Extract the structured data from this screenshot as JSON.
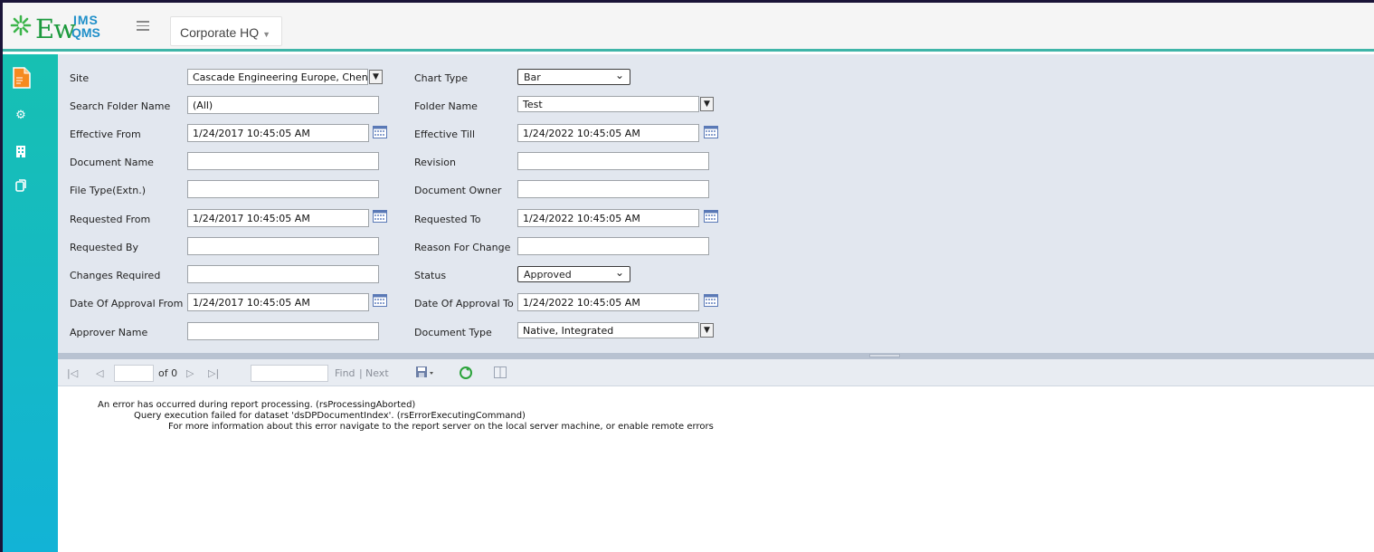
{
  "header": {
    "logo_main": "Ew",
    "logo_top": "IMS",
    "logo_bottom": "QMS",
    "site_selector": "Corporate HQ"
  },
  "sidebar": {
    "items": [
      {
        "icon": "document-icon"
      },
      {
        "icon": "gears-icon"
      },
      {
        "icon": "building-icon"
      },
      {
        "icon": "copy-icon"
      }
    ]
  },
  "params": {
    "site": {
      "label": "Site",
      "value": "Cascade Engineering Europe, Chenr"
    },
    "chart_type": {
      "label": "Chart Type",
      "value": "Bar"
    },
    "search_folder_name": {
      "label": "Search Folder Name",
      "value": "(All)"
    },
    "folder_name": {
      "label": "Folder Name",
      "value": "Test"
    },
    "effective_from": {
      "label": "Effective From",
      "value": "1/24/2017 10:45:05 AM"
    },
    "effective_till": {
      "label": "Effective Till",
      "value": "1/24/2022 10:45:05 AM"
    },
    "document_name": {
      "label": "Document Name",
      "value": ""
    },
    "revision": {
      "label": "Revision",
      "value": ""
    },
    "file_type": {
      "label": "File Type(Extn.)",
      "value": ""
    },
    "document_owner": {
      "label": "Document Owner",
      "value": ""
    },
    "requested_from": {
      "label": "Requested From",
      "value": "1/24/2017 10:45:05 AM"
    },
    "requested_to": {
      "label": "Requested To",
      "value": "1/24/2022 10:45:05 AM"
    },
    "requested_by": {
      "label": "Requested By",
      "value": ""
    },
    "reason_for_change": {
      "label": "Reason For Change",
      "value": ""
    },
    "changes_required": {
      "label": "Changes Required",
      "value": ""
    },
    "status": {
      "label": "Status",
      "value": "Approved"
    },
    "approval_from": {
      "label": "Date Of Approval From",
      "value": "1/24/2017 10:45:05 AM"
    },
    "approval_to": {
      "label": "Date Of Approval To",
      "value": "1/24/2022 10:45:05 AM"
    },
    "approver_name": {
      "label": "Approver Name",
      "value": ""
    },
    "document_type": {
      "label": "Document Type",
      "value": "Native, Integrated"
    }
  },
  "toolbar": {
    "of_pages": "of 0",
    "find": "Find",
    "separator": "|",
    "next": "Next"
  },
  "report": {
    "line1": "An error has occurred during report processing. (rsProcessingAborted)",
    "line2": "Query execution failed for dataset 'dsDPDocumentIndex'. (rsErrorExecutingCommand)",
    "line3": "For more information about this error navigate to the report server on the local server machine, or enable remote errors"
  },
  "colors": {
    "accent": "#3fb5a8",
    "sidebar_top": "#17c0b2",
    "sidebar_bottom": "#12b3d6",
    "panel": "#e2e7ef"
  }
}
